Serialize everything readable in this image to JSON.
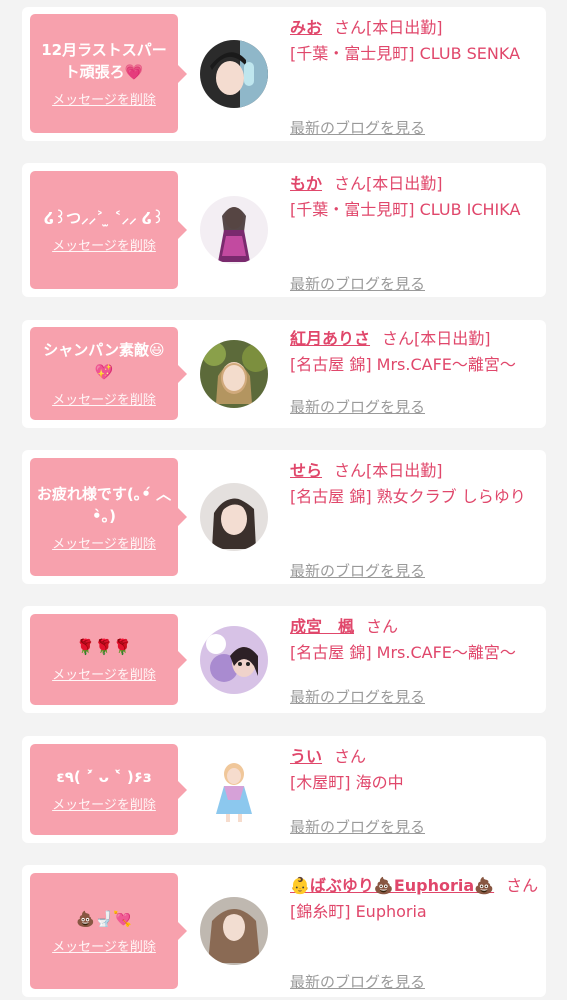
{
  "delete_label": "メッセージを削除",
  "blog_label": "最新のブログを見る",
  "san_label": "さん",
  "colors": {
    "bubble": "#f7a1ad",
    "accent": "#e0476b",
    "muted": "#9a9a9a"
  },
  "items": [
    {
      "message": "12月ラストスパート頑張ろ💗",
      "name": "みお",
      "tag": "[本日出勤]",
      "place": "[千葉・富士見町] CLUB SENKA"
    },
    {
      "message": "໒꒱つ⸝⸝˃ ̫ ˂⸝⸝ ໒꒱",
      "name": "もか",
      "tag": "[本日出勤]",
      "place": "[千葉・富士見町] CLUB ICHIKA"
    },
    {
      "message": "シャンパン素敵😃💖",
      "name": "紅月ありさ",
      "tag": "[本日出勤]",
      "place": "[名古屋 錦] Mrs.CAFE〜離宮〜"
    },
    {
      "message": "お疲れ様です(｡•́ ︿ •̀｡)",
      "name": "せら",
      "tag": "[本日出勤]",
      "place": "[名古屋 錦] 熟女クラブ しらゆり"
    },
    {
      "message": "🌹🌹🌹",
      "name": "成宮　楓",
      "tag": "",
      "place": "[名古屋 錦] Mrs.CAFE〜離宮〜"
    },
    {
      "message": "ε٩( ˃́ ᴗ ˂̀ )۶з",
      "name": "うい",
      "tag": "",
      "place": "[木屋町] 海の中"
    },
    {
      "message": "💩🚽💘",
      "name": "👶ばぶゆり💩Euphoria💩",
      "tag": "",
      "place": "[錦糸町] Euphoria"
    }
  ]
}
